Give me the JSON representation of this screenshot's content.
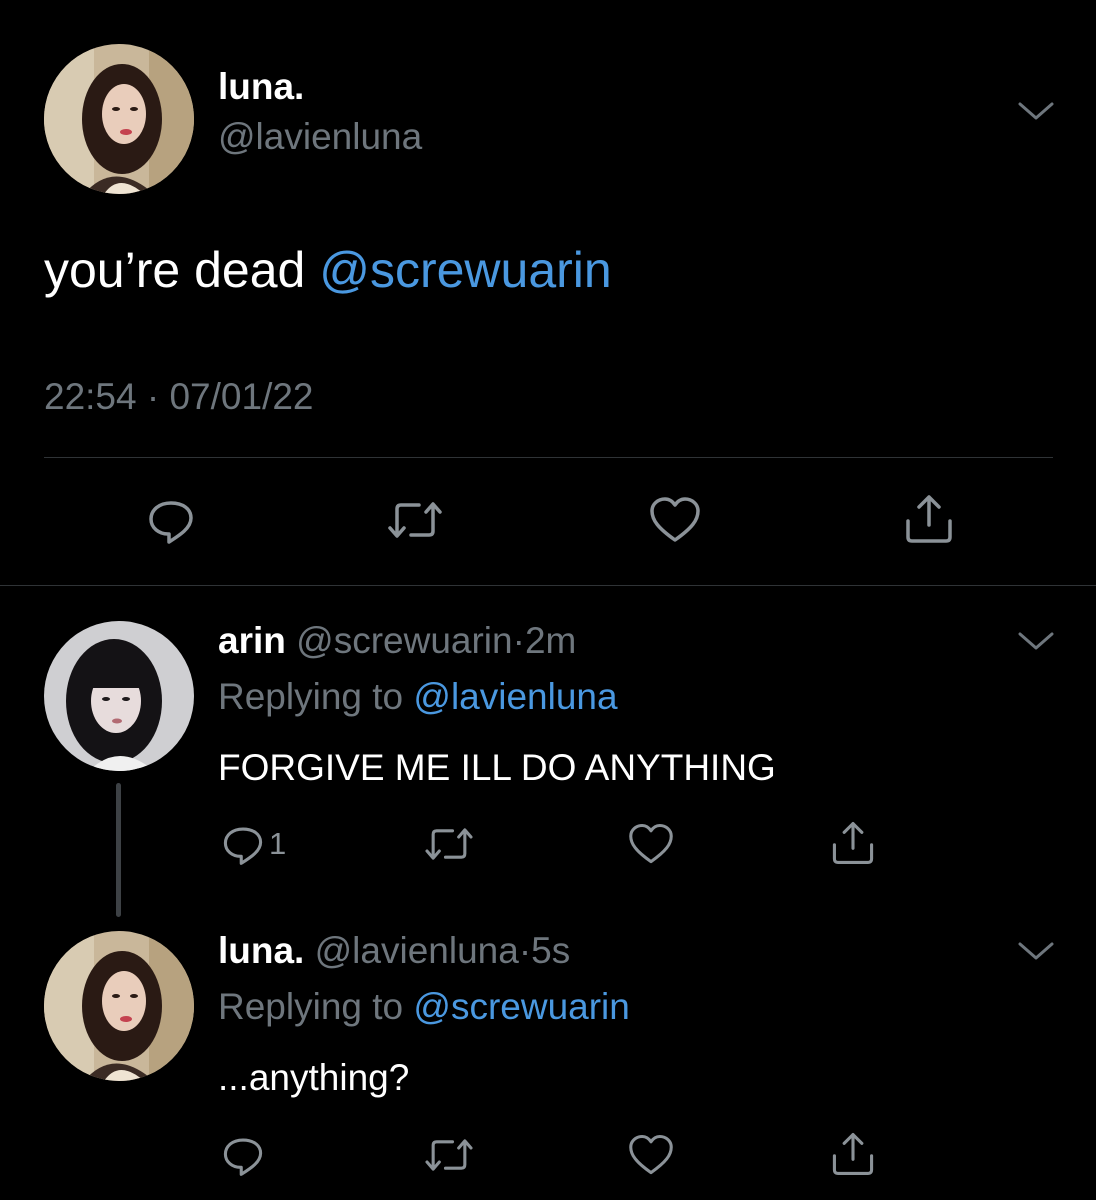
{
  "main_tweet": {
    "display_name": "luna.",
    "handle": "@lavienluna",
    "text": "you’re dead ",
    "mention": "@screwuarin",
    "time": "22:54",
    "separator": "·",
    "date": "07/01/22"
  },
  "reply_1": {
    "display_name": "arin",
    "handle": "@screwuarin",
    "separator": "·",
    "age": "2m",
    "replying_prefix": "Replying to ",
    "replying_to": "@lavienluna",
    "text": "FORGIVE ME ILL DO ANYTHING",
    "reply_count": "1"
  },
  "reply_2": {
    "display_name": "luna.",
    "handle": "@lavienluna",
    "separator": "·",
    "age": "5s",
    "replying_prefix": "Replying to ",
    "replying_to": "@screwuarin",
    "text": "...anything?"
  },
  "icons": {
    "reply": "reply-icon",
    "retweet": "retweet-icon",
    "like": "heart-icon",
    "share": "share-icon",
    "more": "chevron-down-icon"
  },
  "colors": {
    "background": "#000000",
    "text": "#ffffff",
    "muted": "#6e767d",
    "link": "#4a98e0",
    "divider": "#2f3336"
  }
}
